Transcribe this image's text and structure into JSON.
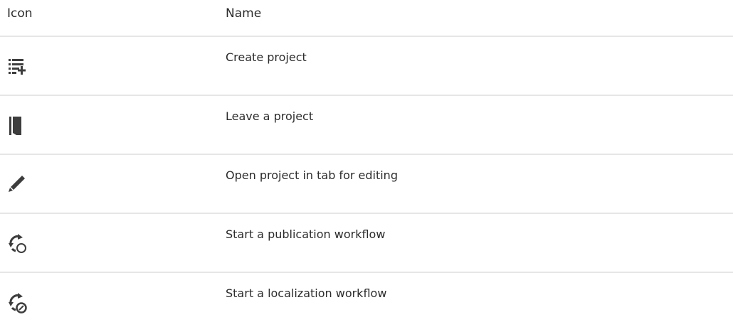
{
  "table": {
    "headers": {
      "icon": "Icon",
      "name": "Name"
    },
    "rows": [
      {
        "icon": "create-project-icon",
        "name": "Create project"
      },
      {
        "icon": "leave-project-icon",
        "name": "Leave a project"
      },
      {
        "icon": "pencil-icon",
        "name": "Open project in tab for editing"
      },
      {
        "icon": "publication-workflow-icon",
        "name": "Start a publication workflow"
      },
      {
        "icon": "localization-workflow-icon",
        "name": "Start a localization workflow"
      }
    ]
  },
  "colors": {
    "icon": "#3d3d3d",
    "divider": "#e6e6e6",
    "text": "#2b2b2b"
  }
}
